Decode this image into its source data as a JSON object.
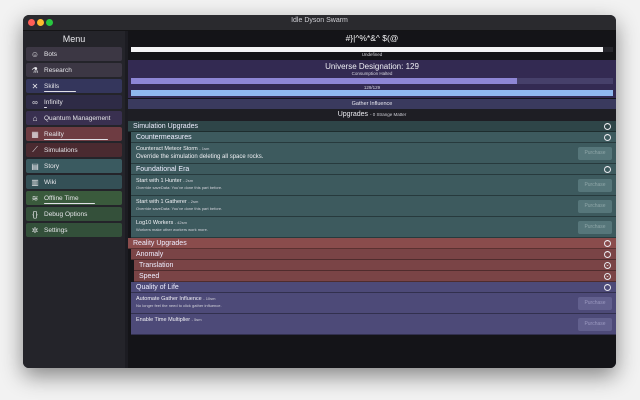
{
  "window": {
    "title": "Idle Dyson Swarm"
  },
  "sidebar": {
    "menu_title": "Menu",
    "items": [
      {
        "label": "Bots",
        "icon": "robot-icon",
        "glyph": "☺",
        "color": "#3c3744",
        "bar": false
      },
      {
        "label": "Research",
        "icon": "research-icon",
        "glyph": "⚗",
        "color": "#3c3744",
        "bar": false
      },
      {
        "label": "Skills",
        "icon": "skills-icon",
        "glyph": "✕",
        "color": "#34365c",
        "bar": true,
        "bar_fill": 0.5
      },
      {
        "label": "Infinity",
        "icon": "infinity-icon",
        "glyph": "∞",
        "color": "#2e2b46",
        "bar": true,
        "bar_fill": 0.05
      },
      {
        "label": "Quantum Management",
        "icon": "bank-icon",
        "glyph": "⌂",
        "color": "#393050",
        "bar": false
      },
      {
        "label": "Reality",
        "icon": "reality-icon",
        "glyph": "▦",
        "color": "#6e3c42",
        "bar": true,
        "bar_fill": 1.0
      },
      {
        "label": "Simulations",
        "icon": "chart-icon",
        "glyph": "⟋",
        "color": "#4a2a30",
        "bar": false
      },
      {
        "label": "Story",
        "icon": "book-icon",
        "glyph": "▤",
        "color": "#3a5a60",
        "bar": false
      },
      {
        "label": "Wiki",
        "icon": "wiki-icon",
        "glyph": "▥",
        "color": "#345056",
        "bar": false
      },
      {
        "label": "Offline Time",
        "icon": "wifi-icon",
        "glyph": "≋",
        "color": "#3a5a3c",
        "bar": true,
        "bar_fill": 0.8
      },
      {
        "label": "Debug Options",
        "icon": "code-icon",
        "glyph": "{}",
        "color": "#34503a",
        "bar": false
      },
      {
        "label": "Settings",
        "icon": "gear-icon",
        "glyph": "✲",
        "color": "#33503a",
        "bar": false
      }
    ]
  },
  "header": {
    "name": "#}|^%*&^ $(@",
    "bar1_label": "Undefined",
    "bar1_fill": 0.98
  },
  "universe": {
    "title": "Universe Designation: 129",
    "subtitle": "Consumption Halted",
    "bar1_fill": 0.8,
    "bar1_color": "#8e86d6",
    "bar2_label": "129/129",
    "bar2_fill": 1.0,
    "bar2_color": "#8fb8ee"
  },
  "gather": {
    "label": "Gather Influence"
  },
  "upgrades": {
    "label": "Upgrades",
    "suffix": "- 0 Strange Matter"
  },
  "sections": {
    "simulation": "Simulation Upgrades",
    "countermeasures": "Countermeasures",
    "foundational": "Foundational Era",
    "reality": "Reality Upgrades",
    "anomaly": "Anomaly",
    "translation": "Translation",
    "speed": "Speed",
    "quality": "Quality of Life"
  },
  "counter_items": [
    {
      "name": "Counteract Meteor Storm",
      "cost": "- 1sm",
      "desc": "Override the simulation deleting all space rocks.",
      "button": "Purchase"
    }
  ],
  "foundational_items": [
    {
      "name": "Start with 1 Hunter",
      "cost": "- 2sm",
      "desc": "Override saveData: You've done this part before.",
      "button": "Purchase"
    },
    {
      "name": "Start with 1 Gatherer",
      "cost": "- 2sm",
      "desc": "Override saveData: You've done this part before.",
      "button": "Purchase"
    },
    {
      "name": "Log10 Workers",
      "cost": "- 42sm",
      "desc": "Workers make other workers work more.",
      "button": "Purchase"
    }
  ],
  "quality_items": [
    {
      "name": "Automate Gather Influence",
      "cost": "- 10sm",
      "desc": "No longer feel the need to click gather influence.",
      "button": "Purchase"
    },
    {
      "name": "Enable Time Multiplier",
      "cost": "- 5sm",
      "desc": "",
      "button": "Purchase"
    }
  ],
  "colors": {
    "teal": "#3d5a5e",
    "red": "#7a4446",
    "purple": "#4d4a78"
  }
}
